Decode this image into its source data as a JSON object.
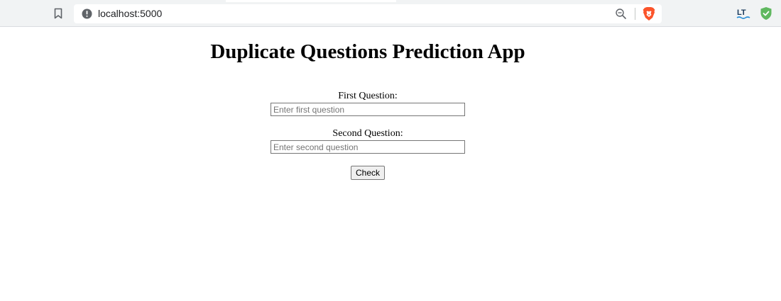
{
  "browser": {
    "url": "localhost:5000",
    "icons": {
      "bookmark": "bookmark-icon",
      "site_info": "site-info-icon",
      "zoom": "zoom-icon",
      "brave": "brave-shields-icon",
      "extension_lt": "languagetool-extension-icon",
      "extension_shield": "shield-extension-icon"
    },
    "colors": {
      "toolbar_bg": "#f1f3f4",
      "brave_orange": "#fb542b",
      "shield_green": "#5fb85f"
    }
  },
  "app": {
    "title": "Duplicate Questions Prediction App",
    "form": {
      "q1_label": "First Question:",
      "q1_placeholder": "Enter first question",
      "q1_value": "",
      "q2_label": "Second Question:",
      "q2_placeholder": "Enter second question",
      "q2_value": "",
      "submit_label": "Check"
    }
  }
}
